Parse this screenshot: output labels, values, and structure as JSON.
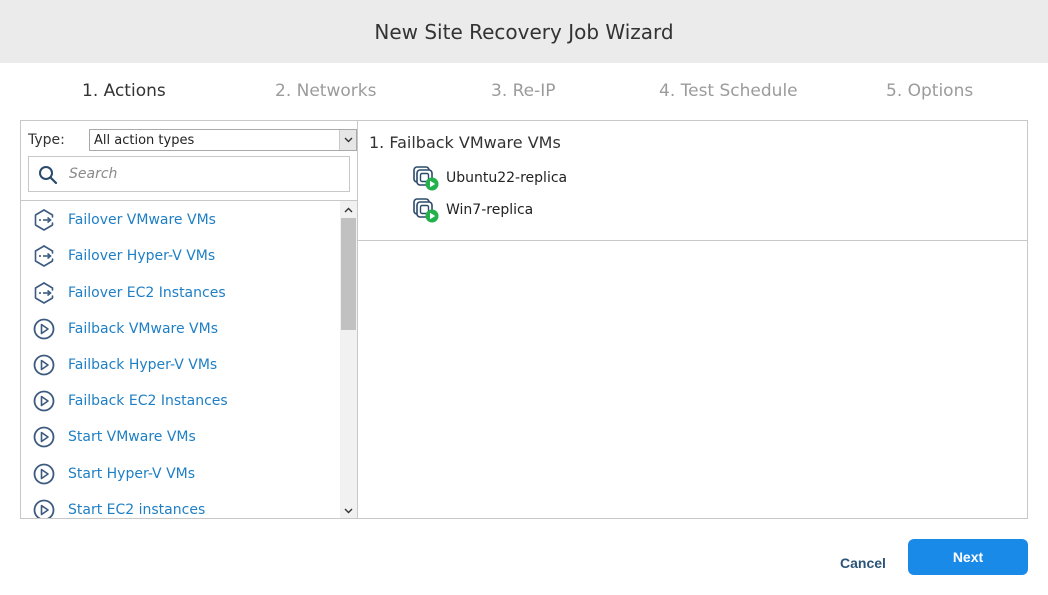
{
  "window": {
    "title": "New Site Recovery Job Wizard"
  },
  "steps": [
    {
      "label": "1. Actions",
      "active": true
    },
    {
      "label": "2. Networks",
      "active": false
    },
    {
      "label": "3. Re-IP",
      "active": false
    },
    {
      "label": "4. Test Schedule",
      "active": false
    },
    {
      "label": "5. Options",
      "active": false
    }
  ],
  "filter": {
    "type_label": "Type:",
    "type_value": "All action types",
    "search_placeholder": "Search"
  },
  "actions": [
    {
      "label": "Failover VMware VMs",
      "icon": "failover-icon"
    },
    {
      "label": "Failover Hyper-V VMs",
      "icon": "failover-icon"
    },
    {
      "label": "Failover EC2 Instances",
      "icon": "failover-icon"
    },
    {
      "label": "Failback VMware VMs",
      "icon": "play-circle-icon"
    },
    {
      "label": "Failback Hyper-V VMs",
      "icon": "play-circle-icon"
    },
    {
      "label": "Failback EC2 Instances",
      "icon": "play-circle-icon"
    },
    {
      "label": "Start VMware VMs",
      "icon": "play-circle-icon"
    },
    {
      "label": "Start Hyper-V VMs",
      "icon": "play-circle-icon"
    },
    {
      "label": "Start EC2 instances",
      "icon": "play-circle-icon"
    }
  ],
  "job": {
    "group_title": "1. Failback VMware VMs",
    "vms": [
      {
        "name": "Ubuntu22-replica",
        "icon": "vm-replica-running-icon"
      },
      {
        "name": "Win7-replica",
        "icon": "vm-replica-running-icon"
      }
    ]
  },
  "footer": {
    "cancel_label": "Cancel",
    "next_label": "Next"
  },
  "colors": {
    "accent": "#1a8ae8",
    "link": "#1f7fc4",
    "running": "#22b24c",
    "title_bar": "#ebebeb"
  }
}
